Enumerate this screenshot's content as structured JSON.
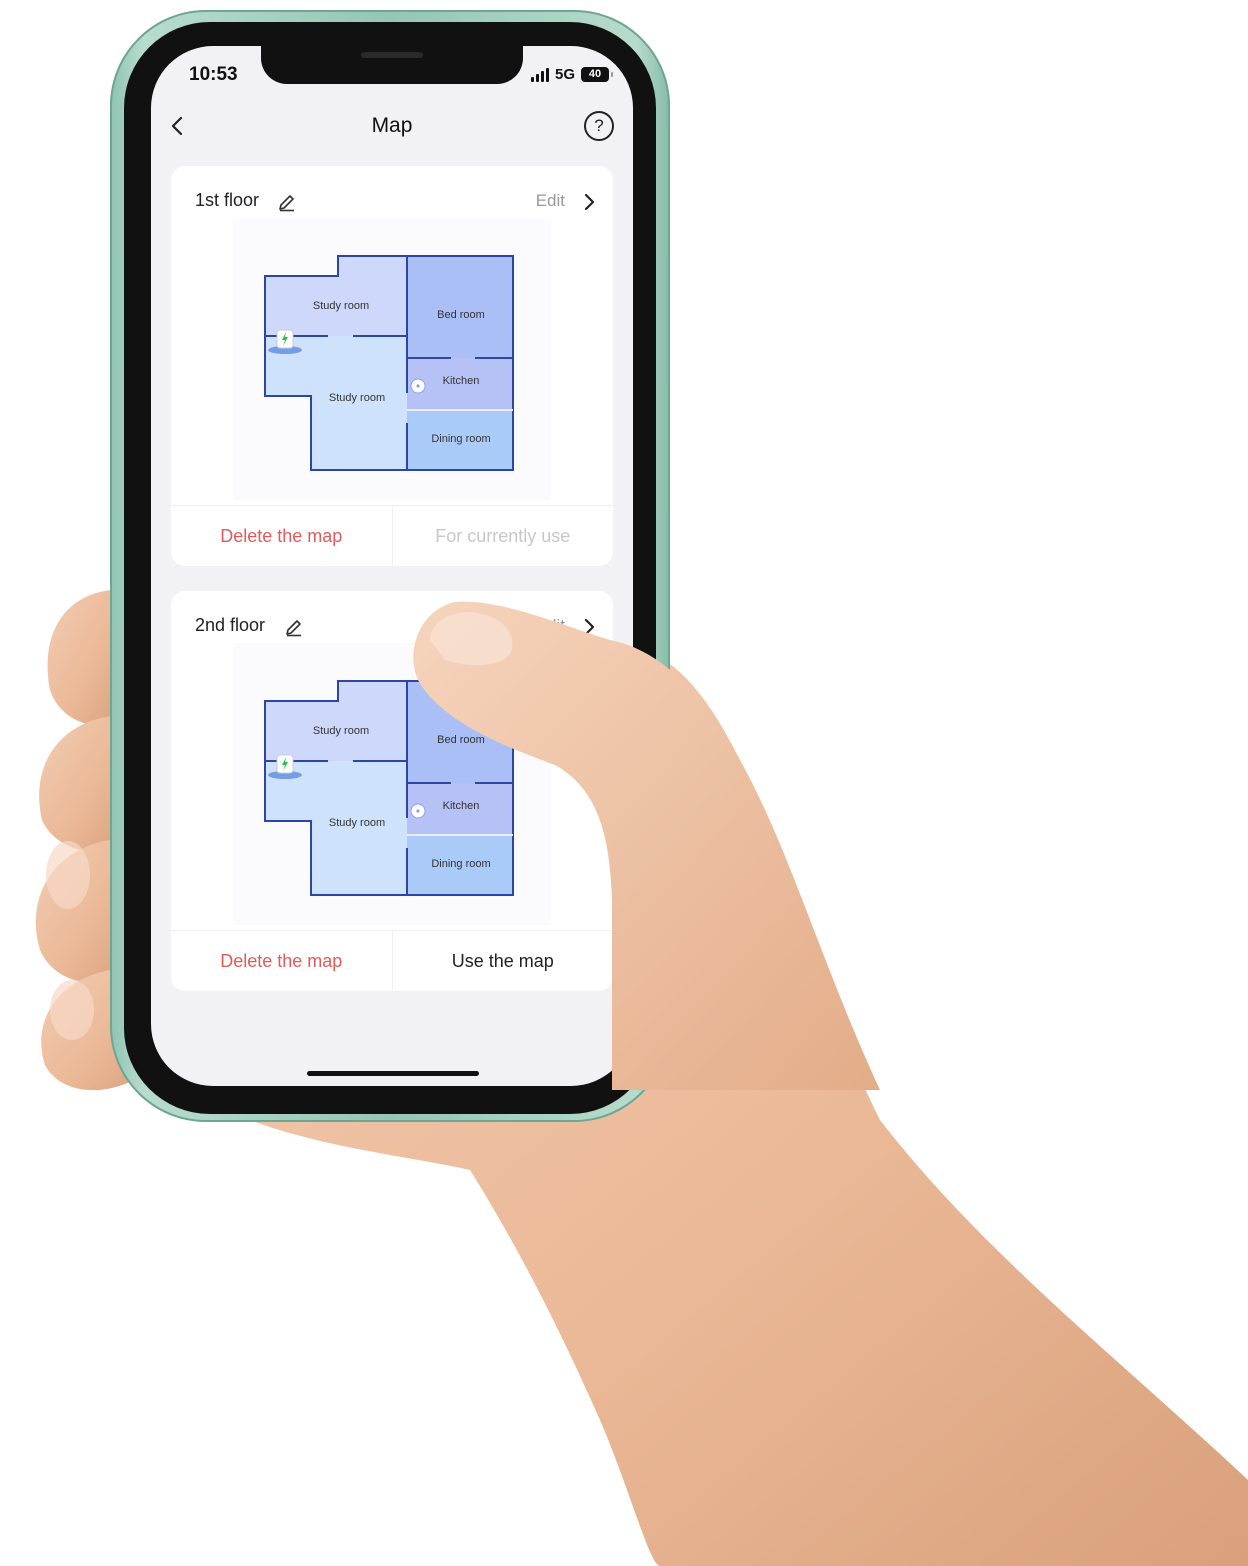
{
  "status_bar": {
    "time": "10:53",
    "network": "5G",
    "battery": "40"
  },
  "nav": {
    "title": "Map",
    "help": "?"
  },
  "maps": [
    {
      "floor_name": "1st floor",
      "edit_label": "Edit",
      "rooms": {
        "study_top": "Study room",
        "study_bottom": "Study room",
        "bedroom": "Bed room",
        "kitchen": "Kitchen",
        "dining": "Dining room"
      },
      "delete_label": "Delete the map",
      "action_label": "For currently use",
      "action_enabled": false
    },
    {
      "floor_name": "2nd floor",
      "edit_label": "Edit",
      "rooms": {
        "study_top": "Study room",
        "study_bottom": "Study room",
        "bedroom": "Bed room",
        "kitchen": "Kitchen",
        "dining": "Dining room"
      },
      "delete_label": "Delete the map",
      "action_label": "Use the map",
      "action_enabled": true
    }
  ],
  "colors": {
    "room_study_top": "#cdd8fb",
    "room_study_bottom": "#cfe2fb",
    "room_bedroom": "#a9bff6",
    "room_kitchen": "#b6c2f5",
    "room_dining": "#aacbf7",
    "wall": "#2c46a8",
    "delete": "#e25a5a"
  }
}
